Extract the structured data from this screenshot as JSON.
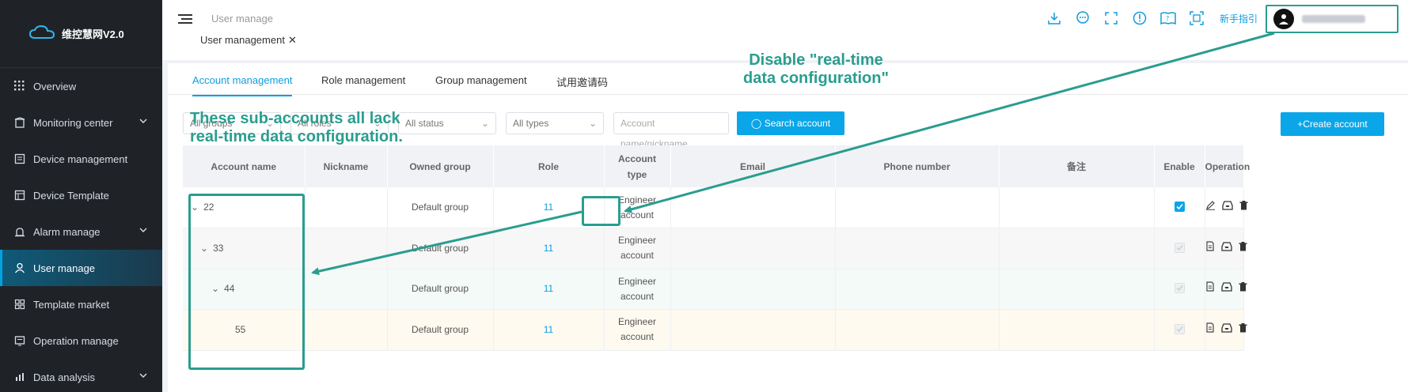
{
  "app": {
    "name": "维控慧网V2.0"
  },
  "sidebar": {
    "items": [
      {
        "label": "Overview",
        "icon": "grid-icon",
        "has_chevron": false,
        "active": false
      },
      {
        "label": "Monitoring center",
        "icon": "building-icon",
        "has_chevron": true,
        "active": false
      },
      {
        "label": "Device management",
        "icon": "device-icon",
        "has_chevron": false,
        "active": false
      },
      {
        "label": "Device Template",
        "icon": "template-icon",
        "has_chevron": false,
        "active": false
      },
      {
        "label": "Alarm manage",
        "icon": "alarm-icon",
        "has_chevron": true,
        "active": false
      },
      {
        "label": "User manage",
        "icon": "user-icon",
        "has_chevron": false,
        "active": true
      },
      {
        "label": "Template market",
        "icon": "market-icon",
        "has_chevron": false,
        "active": false
      },
      {
        "label": "Operation manage",
        "icon": "operation-icon",
        "has_chevron": false,
        "active": false
      },
      {
        "label": "Data analysis",
        "icon": "chart-icon",
        "has_chevron": true,
        "active": false
      }
    ]
  },
  "header": {
    "breadcrumb": "User manage",
    "open_tab": "User management",
    "guide_label": "新手指引",
    "icons": [
      "download-icon",
      "chat-icon",
      "fullscreen-icon",
      "info-icon",
      "help-book-icon",
      "qrcode-icon"
    ]
  },
  "tabs": [
    {
      "label": "Account management",
      "active": true
    },
    {
      "label": "Role management",
      "active": false
    },
    {
      "label": "Group management",
      "active": false
    },
    {
      "label": "试用邀请码",
      "active": false
    }
  ],
  "filters": {
    "group": "All groups",
    "role": "All roles",
    "status": "All status",
    "type": "All types",
    "search_placeholder": "Account name/nickname",
    "search_button": "Search account",
    "create_button": "+Create account"
  },
  "table": {
    "headers": {
      "account_name": "Account name",
      "nickname": "Nickname",
      "owned_group": "Owned group",
      "role": "Role",
      "account_type_1": "Account",
      "account_type_2": "type",
      "email": "Email",
      "phone": "Phone number",
      "remark": "备注",
      "enable": "Enable",
      "operation": "Operation"
    },
    "rows": [
      {
        "name": "22",
        "expand": true,
        "nickname": "",
        "group": "Default group",
        "role": "11",
        "type_1": "Engineer",
        "type_2": "account",
        "email": "",
        "phone": "",
        "remark": "",
        "enabled": true
      },
      {
        "name": "33",
        "expand": true,
        "nickname": "",
        "group": "Default group",
        "role": "11",
        "type_1": "Engineer",
        "type_2": "account",
        "email": "",
        "phone": "",
        "remark": "",
        "enabled": false
      },
      {
        "name": "44",
        "expand": true,
        "nickname": "",
        "group": "Default group",
        "role": "11",
        "type_1": "Engineer",
        "type_2": "account",
        "email": "",
        "phone": "",
        "remark": "",
        "enabled": false
      },
      {
        "name": "55",
        "expand": false,
        "nickname": "",
        "group": "Default group",
        "role": "11",
        "type_1": "Engineer",
        "type_2": "account",
        "email": "",
        "phone": "",
        "remark": "",
        "enabled": false
      }
    ]
  },
  "annotations": {
    "disable_line1": "Disable \"real-time",
    "disable_line2": "data configuration\"",
    "lack_line1": "These sub-accounts all lack",
    "lack_line2": "real-time data configuration.",
    "color": "#2a9d8f"
  },
  "colors": {
    "accent": "#0aa6e8",
    "sidebar_bg": "#1f2328",
    "annotation": "#2a9d8f"
  }
}
